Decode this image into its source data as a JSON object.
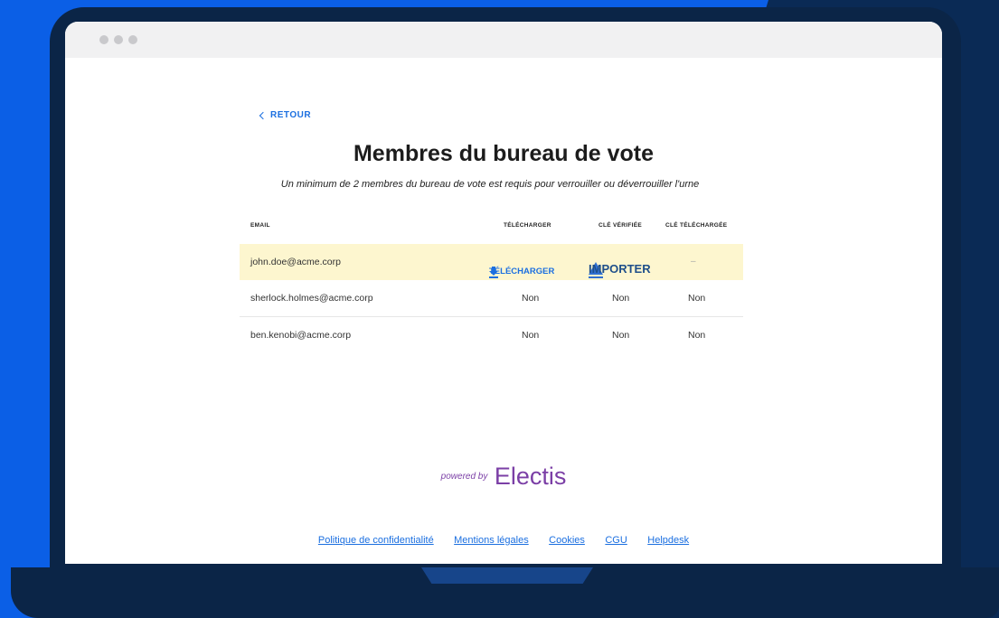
{
  "window": {
    "controls": [
      "close",
      "minimize",
      "maximize"
    ]
  },
  "nav": {
    "back_label": "RETOUR"
  },
  "page": {
    "title": "Membres du bureau de vote",
    "subtitle": "Un minimum de 2 membres du bureau de vote est requis pour verrouiller ou déverrouiller l'urne"
  },
  "table": {
    "headers": {
      "email": "EMAIL",
      "download": "TÉLÉCHARGER",
      "verified": "CLÉ VÉRIFIÉE",
      "key_downloaded": "CLÉ TÉLÉCHARGÉE"
    },
    "rows": [
      {
        "email": "john.doe@acme.corp",
        "download_action": "TÉLÉCHARGER",
        "import_action": "IMPORTER",
        "key_downloaded": "–"
      },
      {
        "email": "sherlock.holmes@acme.corp",
        "download": "Non",
        "verified": "Non",
        "key_downloaded": "Non"
      },
      {
        "email": "ben.kenobi@acme.corp",
        "download": "Non",
        "verified": "Non",
        "key_downloaded": "Non"
      }
    ]
  },
  "brand": {
    "powered_by": "powered by",
    "name": "Electis"
  },
  "footer": {
    "links": [
      "Politique de confidentialité",
      "Mentions légales",
      "Cookies",
      "CGU",
      "Helpdesk"
    ]
  },
  "colors": {
    "accent": "#1b6fe0",
    "highlight_row": "#fdf6cf",
    "brand": "#7b3fa6",
    "background": "#0b5fe6",
    "laptop": "#0b2547"
  }
}
